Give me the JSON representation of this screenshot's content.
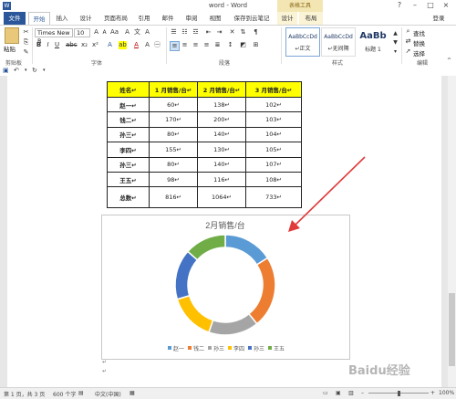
{
  "window": {
    "title": "word - Word",
    "context_tab_group": "表格工具",
    "user": "登录"
  },
  "tabs": [
    "文件",
    "开始",
    "插入",
    "设计",
    "页面布局",
    "引用",
    "邮件",
    "审阅",
    "视图",
    "保存到云笔记",
    "设计",
    "布局"
  ],
  "ribbon": {
    "paste_label": "粘贴",
    "font_name": "Times New R",
    "font_size": "10",
    "group_clipboard": "剪贴板",
    "group_font": "字体",
    "group_paragraph": "段落",
    "group_styles": "样式",
    "group_editing": "编辑",
    "styles": [
      {
        "preview": "AaBbCcDd",
        "name": "↵正文"
      },
      {
        "preview": "AaBbCcDd",
        "name": "↵无间隔"
      },
      {
        "preview": "AaBb",
        "name": "标题 1"
      }
    ],
    "find_label": "查找",
    "replace_label": "替换",
    "select_label": "选择"
  },
  "table": {
    "headers": [
      "姓名↵",
      "1 月销售/台↵",
      "2 月销售/台↵",
      "3 月销售/台↵"
    ],
    "rows": [
      [
        "赵一↵",
        "60↵",
        "138↵",
        "102↵"
      ],
      [
        "钱二↵",
        "170↵",
        "200↵",
        "103↵"
      ],
      [
        "孙三↵",
        "80↵",
        "140↵",
        "104↵"
      ],
      [
        "李四↵",
        "155↵",
        "130↵",
        "105↵"
      ],
      [
        "孙三↵",
        "80↵",
        "140↵",
        "107↵"
      ],
      [
        "王五↵",
        "98↵",
        "116↵",
        "108↵"
      ],
      [
        "总数↵",
        "816↵",
        "1064↵",
        "733↵"
      ]
    ]
  },
  "chart_data": {
    "type": "pie",
    "subtype": "doughnut",
    "title": "2月销售/台",
    "categories": [
      "赵一",
      "钱二",
      "孙三",
      "李四",
      "孙三",
      "王五"
    ],
    "values": [
      138,
      200,
      140,
      130,
      140,
      116
    ],
    "colors": [
      "#5b9bd5",
      "#ed7d31",
      "#a5a5a5",
      "#ffc000",
      "#4472c4",
      "#70ad47"
    ],
    "legend_position": "bottom"
  },
  "annotation": {
    "arrow_color": "#e03a3a"
  },
  "status": {
    "page": "第 1 页，共 3 页",
    "words": "600 个字",
    "lang": "中文(中国)",
    "zoom": "100%"
  },
  "watermark": "Baidu经验"
}
